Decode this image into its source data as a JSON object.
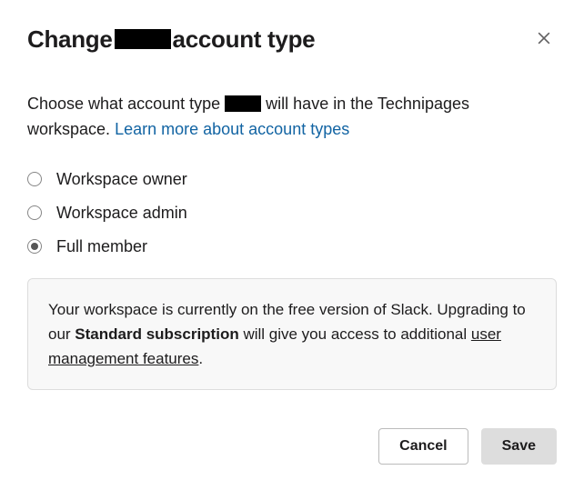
{
  "header": {
    "title_prefix": "Change",
    "title_suffix": "account type"
  },
  "description": {
    "part1": "Choose what account type",
    "part2": "will have in the Technipages workspace.",
    "link_text": "Learn more about account types"
  },
  "options": [
    {
      "label": "Workspace owner",
      "selected": false
    },
    {
      "label": "Workspace admin",
      "selected": false
    },
    {
      "label": "Full member",
      "selected": true
    }
  ],
  "info": {
    "part1": "Your workspace is currently on the free version of Slack. Upgrading to our ",
    "bold": "Standard subscription",
    "part2": " will give you access to additional ",
    "link": "user management features",
    "part3": "."
  },
  "footer": {
    "cancel": "Cancel",
    "save": "Save"
  }
}
